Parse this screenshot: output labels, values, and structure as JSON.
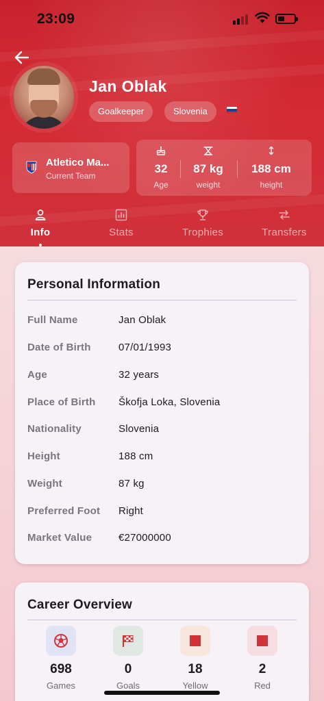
{
  "status_bar": {
    "time": "23:09"
  },
  "player": {
    "name": "Jan Oblak",
    "position": "Goalkeeper",
    "country": "Slovenia",
    "flag_colors": [
      "#ffffff",
      "#1d3f9a",
      "#d7282f"
    ]
  },
  "team": {
    "name": "Atletico Ma...",
    "label": "Current Team"
  },
  "quick_stats": [
    {
      "icon": "cake-icon",
      "value": "32",
      "label": "Age"
    },
    {
      "icon": "scale-icon",
      "value": "87 kg",
      "label": "weight"
    },
    {
      "icon": "height-arrows-icon",
      "value": "188 cm",
      "label": "height"
    }
  ],
  "tabs": [
    {
      "icon": "person-icon",
      "label": "Info",
      "active": true
    },
    {
      "icon": "bar-chart-icon",
      "label": "Stats",
      "active": false
    },
    {
      "icon": "trophy-icon",
      "label": "Trophies",
      "active": false
    },
    {
      "icon": "swap-arrows-icon",
      "label": "Transfers",
      "active": false
    }
  ],
  "personal_info": {
    "title": "Personal Information",
    "rows": [
      {
        "label": "Full Name",
        "value": "Jan Oblak"
      },
      {
        "label": "Date of Birth",
        "value": "07/01/1993"
      },
      {
        "label": "Age",
        "value": "32 years"
      },
      {
        "label": "Place of Birth",
        "value": "Škofja Loka, Slovenia"
      },
      {
        "label": "Nationality",
        "value": "Slovenia"
      },
      {
        "label": "Height",
        "value": "188 cm"
      },
      {
        "label": "Weight",
        "value": "87 kg"
      },
      {
        "label": "Preferred Foot",
        "value": "Right"
      },
      {
        "label": "Market Value",
        "value": "€27000000"
      }
    ]
  },
  "career_overview": {
    "title": "Career Overview",
    "items": [
      {
        "icon": "soccer-ball-icon",
        "value": "698",
        "label": "Games",
        "icon_bg": "#dfe3f4",
        "icon_color": "#d0343b"
      },
      {
        "icon": "checkered-flag-icon",
        "value": "0",
        "label": "Goals",
        "icon_bg": "#dfe8e2",
        "icon_color": "#d0343b"
      },
      {
        "icon": "yellow-card-icon",
        "value": "18",
        "label": "Yellow",
        "icon_bg": "#f6e6dc",
        "icon_color": "#d0343b"
      },
      {
        "icon": "red-card-icon",
        "value": "2",
        "label": "Red",
        "icon_bg": "#f6dde2",
        "icon_color": "#d0343b"
      }
    ]
  },
  "colors": {
    "primary": "#d42a33",
    "card_bg": "#f7f1f8"
  }
}
